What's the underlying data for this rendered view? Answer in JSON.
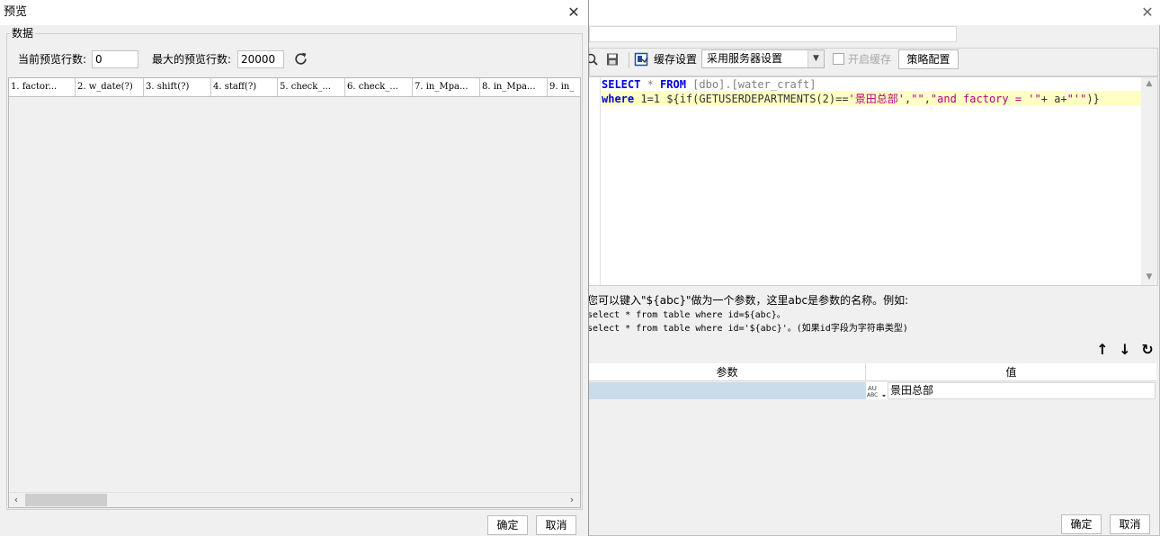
{
  "preview_dialog": {
    "title": "预览",
    "group_label": "数据",
    "current_rows_label": "当前预览行数:",
    "current_rows_value": "0",
    "max_rows_label": "最大的预览行数:",
    "max_rows_value": "20000",
    "columns": [
      "1. factor...",
      "2. w_date(?)",
      "3. shift(?)",
      "4. staff(?)",
      "5. check_...",
      "6. check_...",
      "7. in_Mpa...",
      "8. in_Mpa...",
      "9. in_"
    ],
    "ok_label": "确定",
    "cancel_label": "取消"
  },
  "dataset_dialog": {
    "toolbar": {
      "cache_settings_label": "缓存设置",
      "cache_mode": "采用服务器设置",
      "enable_cache_label": "开启缓存",
      "strategy_button": "策略配置"
    },
    "sql": {
      "line1": {
        "kw1": "SELECT",
        "op": " * ",
        "kw2": "FROM",
        "rest": " [dbo].[water_craft]"
      },
      "line2": {
        "kw": "where",
        "mid": " 1=1 ${if(GETUSERDEPARTMENTS(2)==",
        "s1": "'景田总部'",
        "c1": ",",
        "s2": "\"\"",
        "c2": ",",
        "s3": "\"and factory = '\"",
        "tail1": "+ a+",
        "s4": "\"'\"",
        "tail2": ")}"
      }
    },
    "hint": {
      "line1": "您可以键入\"${abc}\"做为一个参数，这里abc是参数的名称。例如:",
      "line2": "select * from table where id=${abc}。",
      "line3": "select * from table where id='${abc}'。(如果id字段为字符串类型)"
    },
    "params_table": {
      "headers": [
        "参数",
        "值"
      ],
      "rows": [
        {
          "name": "",
          "type": "ABC",
          "value": "景田总部"
        }
      ]
    },
    "ok_label": "确定",
    "cancel_label": "取消"
  }
}
